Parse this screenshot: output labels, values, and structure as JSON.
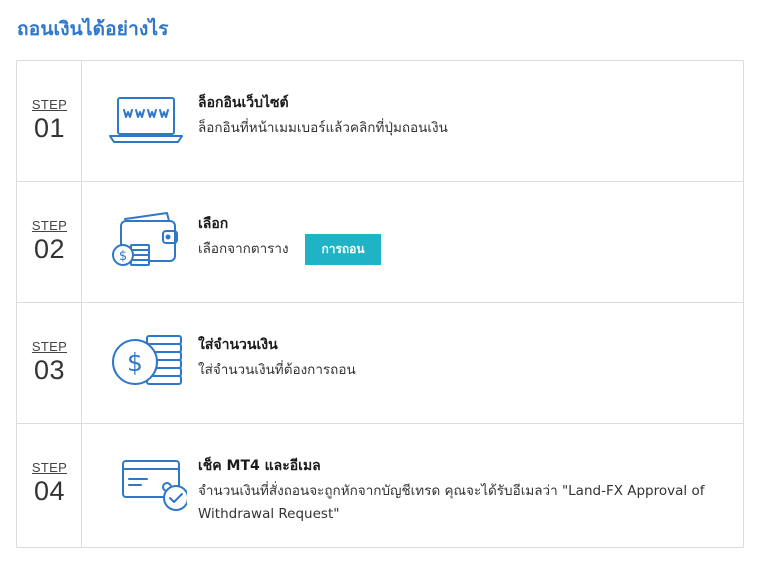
{
  "page": {
    "title": "ถอนเงินได้อย่างไร"
  },
  "colors": {
    "accent": "#2f77c9",
    "button": "#1fb3c5",
    "border": "#dcdcdc"
  },
  "steps": [
    {
      "label": "STEP",
      "number": "01",
      "icon": "laptop-www-icon",
      "title": "ล็อกอินเว็บไซต์",
      "description": "ล็อกอินที่หน้าเมมเบอร์แล้วคลิกที่ปุ่มถอนเงิน"
    },
    {
      "label": "STEP",
      "number": "02",
      "icon": "wallet-coins-icon",
      "title": "เลือก",
      "description": "เลือกจากตาราง",
      "button_label": "การถอน"
    },
    {
      "label": "STEP",
      "number": "03",
      "icon": "dollar-coin-stack-icon",
      "title": "ใส่จำนวนเงิน",
      "description": "ใส่จำนวนเงินที่ต้องการถอน"
    },
    {
      "label": "STEP",
      "number": "04",
      "icon": "card-check-icon",
      "title": "เช็ค MT4 และอีเมล",
      "description": "จำนวนเงินที่สั่งถอนจะถูกหักจากบัญชีเทรด คุณจะได้รับอีเมลว่า \"Land-FX Approval of Withdrawal Request\""
    }
  ]
}
